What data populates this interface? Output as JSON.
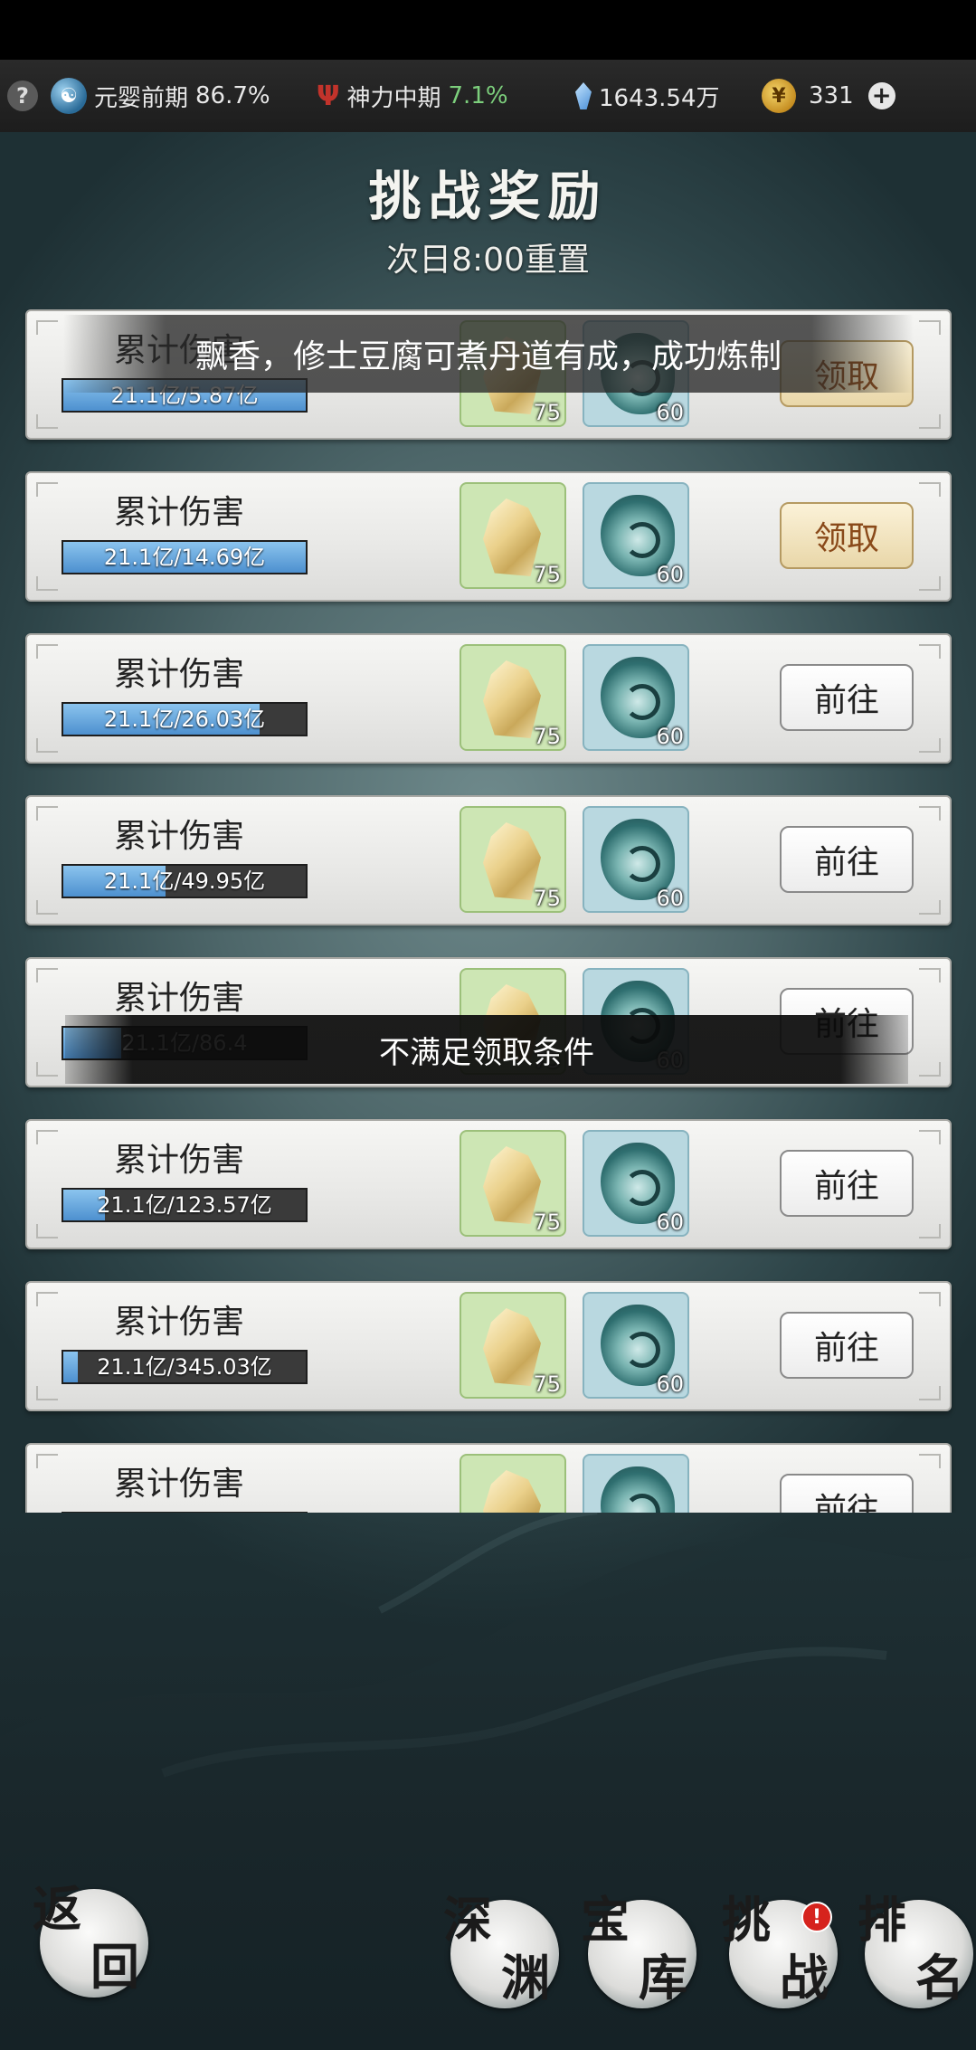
{
  "topbar": {
    "help_glyph": "?",
    "realm_label": "元婴前期",
    "realm_pct": "86.7%",
    "divine_label": "神力中期",
    "divine_pct": "7.1%",
    "spirit_stones": "1643.54万",
    "gold": "331",
    "plus_glyph": "+"
  },
  "header": {
    "title": "挑战奖励",
    "subtitle": "次日8:00重置"
  },
  "toasts": {
    "top": "飘香，修士豆腐可煮丹道有成，成功炼制",
    "middle": "不满足领取条件"
  },
  "rows": [
    {
      "label": "累计伤害",
      "progress_text": "21.1亿/5.87亿",
      "progress": 1.0,
      "reward1_count": "75",
      "reward2_count": "60",
      "button": "领取",
      "state": "claim"
    },
    {
      "label": "累计伤害",
      "progress_text": "21.1亿/14.69亿",
      "progress": 1.0,
      "reward1_count": "75",
      "reward2_count": "60",
      "button": "领取",
      "state": "claim"
    },
    {
      "label": "累计伤害",
      "progress_text": "21.1亿/26.03亿",
      "progress": 0.81,
      "reward1_count": "75",
      "reward2_count": "60",
      "button": "前往",
      "state": "goto"
    },
    {
      "label": "累计伤害",
      "progress_text": "21.1亿/49.95亿",
      "progress": 0.42,
      "reward1_count": "75",
      "reward2_count": "60",
      "button": "前往",
      "state": "goto"
    },
    {
      "label": "累计伤害",
      "progress_text": "21.1亿/86.4",
      "progress": 0.24,
      "reward1_count": "75",
      "reward2_count": "60",
      "button": "前往",
      "state": "goto"
    },
    {
      "label": "累计伤害",
      "progress_text": "21.1亿/123.57亿",
      "progress": 0.17,
      "reward1_count": "75",
      "reward2_count": "60",
      "button": "前往",
      "state": "goto"
    },
    {
      "label": "累计伤害",
      "progress_text": "21.1亿/345.03亿",
      "progress": 0.06,
      "reward1_count": "75",
      "reward2_count": "60",
      "button": "前往",
      "state": "goto"
    },
    {
      "label": "累计伤害",
      "progress_text": "",
      "progress": 0.03,
      "reward1_count": "",
      "reward2_count": "",
      "button": "前往",
      "state": "goto"
    }
  ],
  "bottom_nav": {
    "back": [
      "返",
      "回"
    ],
    "abyss": [
      "深",
      "渊"
    ],
    "treasury": [
      "宝",
      "库"
    ],
    "challenge": [
      "挑",
      "战"
    ],
    "ranking": [
      "排",
      "名"
    ],
    "challenge_badge": "!"
  },
  "icons": {
    "help": "question-icon",
    "realm": "yinyang-icon",
    "divine": "trident-icon",
    "stone": "crystal-icon",
    "gold": "coin-icon",
    "reward1": "gold-crystal-icon",
    "reward2": "jade-swirl-icon"
  },
  "colors": {
    "progress_fill": "#4d90cf",
    "claim_text": "#8a4a1a",
    "badge": "#d6231d",
    "green_pct": "#7ccf7c"
  }
}
